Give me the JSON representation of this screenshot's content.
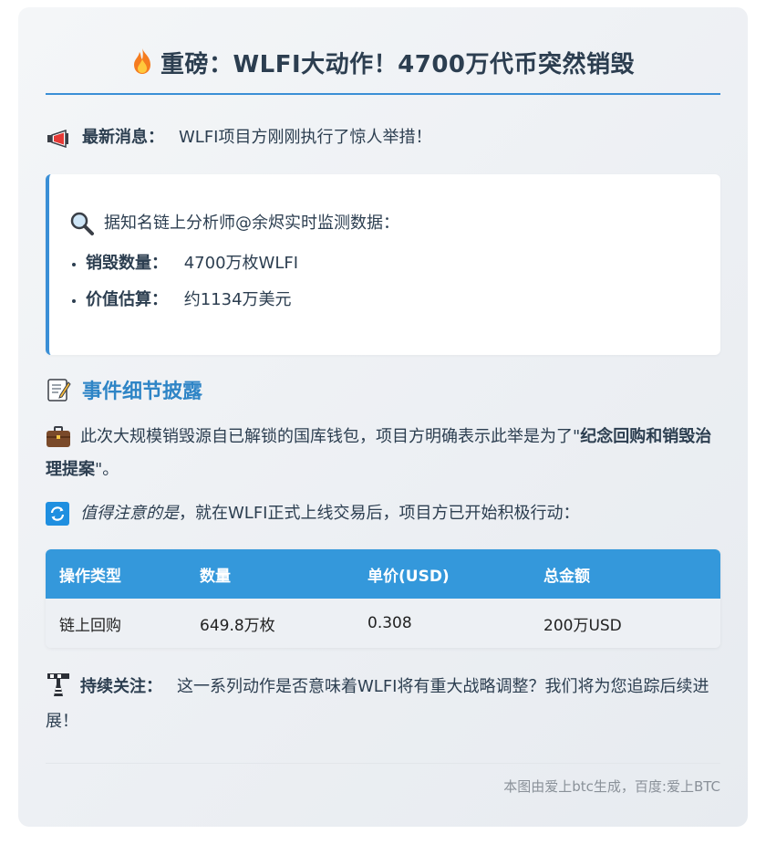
{
  "title": "重磅：WLFI大动作！4700万代币突然销毁",
  "news": {
    "label": "最新消息：",
    "text": "WLFI项目方刚刚执行了惊人举措！"
  },
  "info_box": {
    "intro": "据知名链上分析师@余烬实时监测数据：",
    "items": [
      {
        "label": "销毁数量：",
        "value": "4700万枚WLFI"
      },
      {
        "label": "价值估算：",
        "value": "约1134万美元"
      }
    ]
  },
  "section": {
    "title": "事件细节披露"
  },
  "detail": {
    "text": "此次大规模销毁源自已解锁的国库钱包，项目方明确表示此举是为了\"",
    "bold": "纪念回购和销毁治理提案",
    "end": "\"。"
  },
  "notice": {
    "italic": "值得注意的是",
    "text": "，就在WLFI正式上线交易后，项目方已开始积极行动："
  },
  "table": {
    "headers": [
      "操作类型",
      "数量",
      "单价(USD)",
      "总金额"
    ],
    "rows": [
      [
        "链上回购",
        "649.8万枚",
        "0.308",
        "200万USD"
      ]
    ]
  },
  "follow": {
    "label": "持续关注：",
    "text": "这一系列动作是否意味着WLFI将有重大战略调整？我们将为您追踪后续进展！"
  },
  "footer": "本图由爱上btc生成，百度:爱上BTC",
  "colors": {
    "accent": "#3498db",
    "section_title": "#2f85c6",
    "text": "#2c3e50"
  },
  "icons": [
    "fire-icon",
    "megaphone-icon",
    "magnifier-icon",
    "memo-icon",
    "briefcase-icon",
    "repeat-icon",
    "construction-icon"
  ]
}
